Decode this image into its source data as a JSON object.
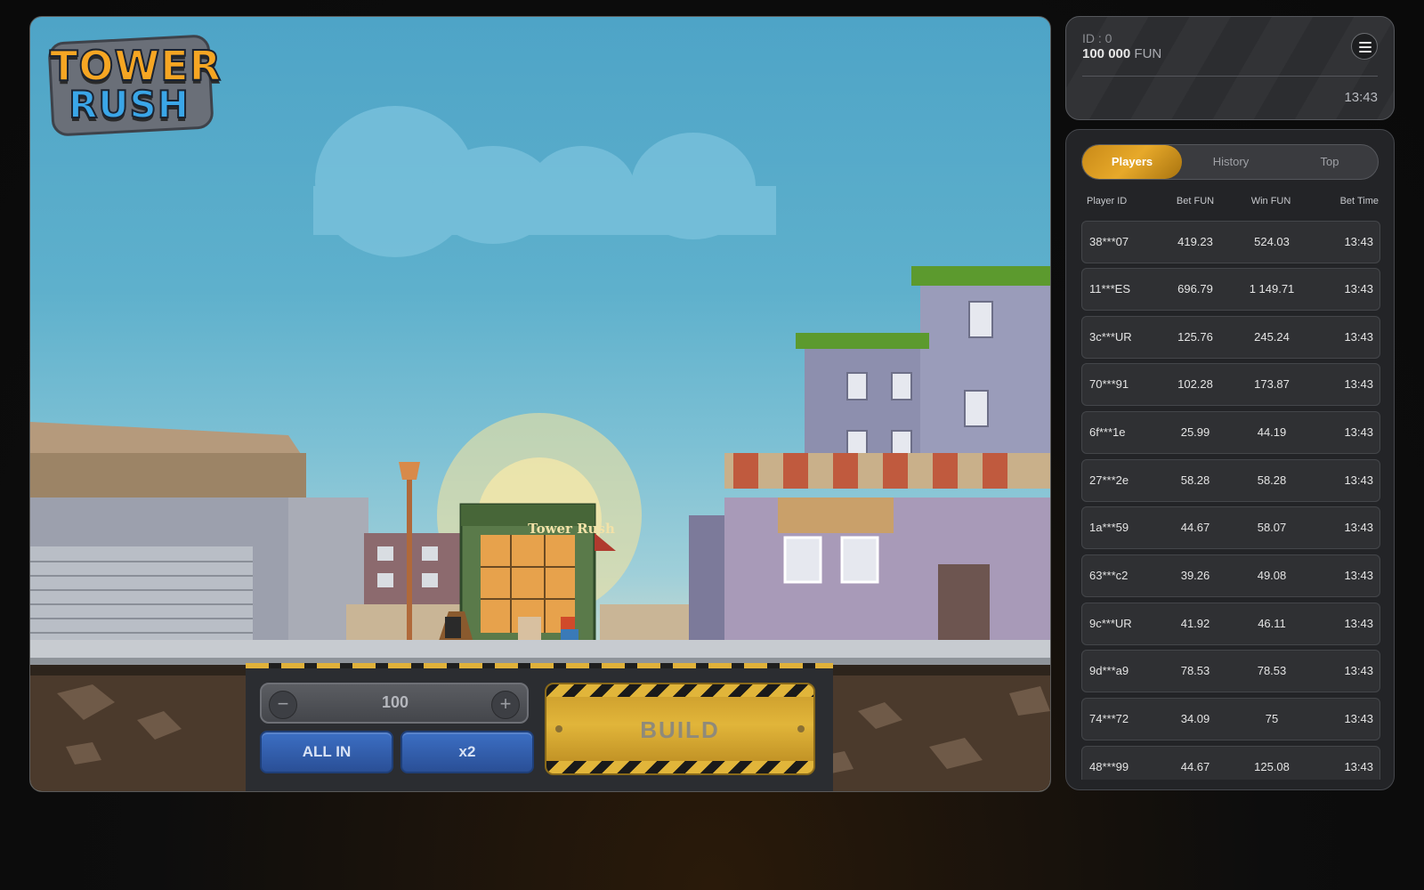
{
  "game": {
    "logo_line1": "TOWER",
    "logo_line2": "RUSH",
    "shop_sign": "Tower Rush",
    "bet_amount": "100",
    "minus_symbol": "−",
    "plus_symbol": "+",
    "all_in_label": "ALL IN",
    "x2_label": "x2",
    "build_label": "BUILD"
  },
  "account": {
    "id_label": "ID : 0",
    "balance": "100 000",
    "currency": "FUN",
    "time": "13:43",
    "menu_icon": "hamburger-menu-icon"
  },
  "players_panel": {
    "tabs": [
      {
        "label": "Players",
        "active": true
      },
      {
        "label": "History",
        "active": false
      },
      {
        "label": "Top",
        "active": false
      }
    ],
    "columns": [
      "Player ID",
      "Bet  FUN",
      "Win  FUN",
      "Bet Time"
    ],
    "rows": [
      {
        "id": "38***07",
        "bet": "419.23",
        "win": "524.03",
        "time": "13:43"
      },
      {
        "id": "11***ES",
        "bet": "696.79",
        "win": "1 149.71",
        "time": "13:43"
      },
      {
        "id": "3c***UR",
        "bet": "125.76",
        "win": "245.24",
        "time": "13:43"
      },
      {
        "id": "70***91",
        "bet": "102.28",
        "win": "173.87",
        "time": "13:43"
      },
      {
        "id": "6f***1e",
        "bet": "25.99",
        "win": "44.19",
        "time": "13:43"
      },
      {
        "id": "27***2e",
        "bet": "58.28",
        "win": "58.28",
        "time": "13:43"
      },
      {
        "id": "1a***59",
        "bet": "44.67",
        "win": "58.07",
        "time": "13:43"
      },
      {
        "id": "63***c2",
        "bet": "39.26",
        "win": "49.08",
        "time": "13:43"
      },
      {
        "id": "9c***UR",
        "bet": "41.92",
        "win": "46.11",
        "time": "13:43"
      },
      {
        "id": "9d***a9",
        "bet": "78.53",
        "win": "78.53",
        "time": "13:43"
      },
      {
        "id": "74***72",
        "bet": "34.09",
        "win": "75",
        "time": "13:43"
      },
      {
        "id": "48***99",
        "bet": "44.67",
        "win": "125.08",
        "time": "13:43"
      }
    ]
  },
  "colors": {
    "accent_gold": "#e1b53a",
    "button_blue": "#2a4f96",
    "tab_active": "#e7a92a",
    "panel_bg": "#232427"
  }
}
